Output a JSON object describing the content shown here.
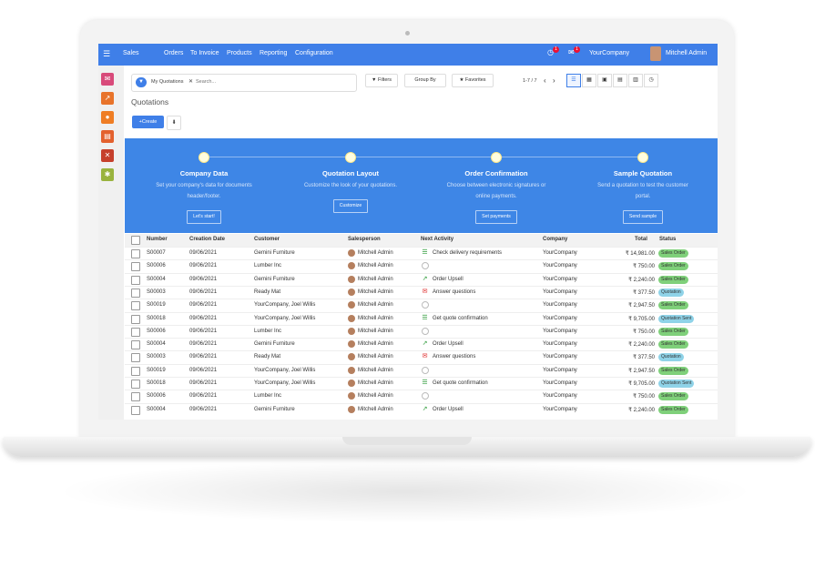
{
  "topnav": {
    "app": "Sales",
    "menu": [
      "Orders",
      "To Invoice",
      "Products",
      "Reporting",
      "Configuration"
    ],
    "activity_badge": "1",
    "chat_badge": "1",
    "company": "YourCompany",
    "user": "Mitchell Admin"
  },
  "sidebar": {
    "icons": [
      {
        "name": "discuss-icon",
        "color": "#d84a7a"
      },
      {
        "name": "dashboard-icon",
        "color": "#e8732a"
      },
      {
        "name": "website-icon",
        "color": "#ef7d24"
      },
      {
        "name": "invoice-icon",
        "color": "#e3612e"
      },
      {
        "name": "crm-icon",
        "color": "#c6402c"
      },
      {
        "name": "settings-icon",
        "color": "#99b33e"
      }
    ]
  },
  "control": {
    "facet": "My Quotations",
    "search_placeholder": "Search...",
    "filters": "Filters",
    "group_by": "Group By",
    "favorites": "Favorites",
    "pager": "1-7 / 7"
  },
  "page": {
    "title": "Quotations",
    "create": "Create"
  },
  "onboarding": [
    {
      "title": "Company Data",
      "desc": "Set your company's data for documents header/footer.",
      "button": "Let's start!"
    },
    {
      "title": "Quotation Layout",
      "desc": "Customize the look of your quotations.",
      "button": "Customize"
    },
    {
      "title": "Order Confirmation",
      "desc": "Choose between electronic signatures or online payments.",
      "button": "Set payments"
    },
    {
      "title": "Sample Quotation",
      "desc": "Send a quotation to test the customer portal.",
      "button": "Send sample"
    }
  ],
  "table": {
    "headers": [
      "Number",
      "Creation Date",
      "Customer",
      "Salesperson",
      "Next Activity",
      "Company",
      "Total",
      "Status"
    ],
    "rows": [
      {
        "number": "S00007",
        "date": "09/06/2021",
        "customer": "Gemini Furniture",
        "salesperson": "Mitchell Admin",
        "activity": "Check delivery requirements",
        "activity_icon": "todo",
        "company": "YourCompany",
        "total": "₹ 14,981.00",
        "status": "Sales Order"
      },
      {
        "number": "S00006",
        "date": "09/06/2021",
        "customer": "Lumber Inc",
        "salesperson": "Mitchell Admin",
        "activity": "",
        "activity_icon": "none",
        "company": "YourCompany",
        "total": "₹ 750.00",
        "status": "Sales Order"
      },
      {
        "number": "S00004",
        "date": "09/06/2021",
        "customer": "Gemini Furniture",
        "salesperson": "Mitchell Admin",
        "activity": "Order Upsell",
        "activity_icon": "upsell",
        "company": "YourCompany",
        "total": "₹ 2,240.00",
        "status": "Sales Order"
      },
      {
        "number": "S00003",
        "date": "09/06/2021",
        "customer": "Ready Mat",
        "salesperson": "Mitchell Admin",
        "activity": "Answer questions",
        "activity_icon": "email",
        "company": "YourCompany",
        "total": "₹ 377.50",
        "status": "Quotation"
      },
      {
        "number": "S00019",
        "date": "09/06/2021",
        "customer": "YourCompany, Joel Willis",
        "salesperson": "Mitchell Admin",
        "activity": "",
        "activity_icon": "none",
        "company": "YourCompany",
        "total": "₹ 2,947.50",
        "status": "Sales Order"
      },
      {
        "number": "S00018",
        "date": "09/06/2021",
        "customer": "YourCompany, Joel Willis",
        "salesperson": "Mitchell Admin",
        "activity": "Get quote confirmation",
        "activity_icon": "todo",
        "company": "YourCompany",
        "total": "₹ 9,705.00",
        "status": "Quotation Sent"
      },
      {
        "number": "S00006",
        "date": "09/06/2021",
        "customer": "Lumber Inc",
        "salesperson": "Mitchell Admin",
        "activity": "",
        "activity_icon": "none",
        "company": "YourCompany",
        "total": "₹ 750.00",
        "status": "Sales Order"
      },
      {
        "number": "S00004",
        "date": "09/06/2021",
        "customer": "Gemini Furniture",
        "salesperson": "Mitchell Admin",
        "activity": "Order Upsell",
        "activity_icon": "upsell",
        "company": "YourCompany",
        "total": "₹ 2,240.00",
        "status": "Sales Order"
      },
      {
        "number": "S00003",
        "date": "09/06/2021",
        "customer": "Ready Mat",
        "salesperson": "Mitchell Admin",
        "activity": "Answer questions",
        "activity_icon": "email",
        "company": "YourCompany",
        "total": "₹ 377.50",
        "status": "Quotation"
      },
      {
        "number": "S00019",
        "date": "09/06/2021",
        "customer": "YourCompany, Joel Willis",
        "salesperson": "Mitchell Admin",
        "activity": "",
        "activity_icon": "none",
        "company": "YourCompany",
        "total": "₹ 2,947.50",
        "status": "Sales Order"
      },
      {
        "number": "S00018",
        "date": "09/06/2021",
        "customer": "YourCompany, Joel Willis",
        "salesperson": "Mitchell Admin",
        "activity": "Get quote confirmation",
        "activity_icon": "todo",
        "company": "YourCompany",
        "total": "₹ 9,705.00",
        "status": "Quotation Sent"
      },
      {
        "number": "S00006",
        "date": "09/06/2021",
        "customer": "Lumber Inc",
        "salesperson": "Mitchell Admin",
        "activity": "",
        "activity_icon": "none",
        "company": "YourCompany",
        "total": "₹ 750.00",
        "status": "Sales Order"
      },
      {
        "number": "S00004",
        "date": "09/06/2021",
        "customer": "Gemini Furniture",
        "salesperson": "Mitchell Admin",
        "activity": "Order Upsell",
        "activity_icon": "upsell",
        "company": "YourCompany",
        "total": "₹ 2,240.00",
        "status": "Sales Order"
      }
    ]
  },
  "colors": {
    "brand": "#3f7fe8",
    "status_sales_order": "#7fd07a",
    "status_quotation": "#8fd3e8",
    "status_quotation_sent": "#8fd3e8"
  }
}
